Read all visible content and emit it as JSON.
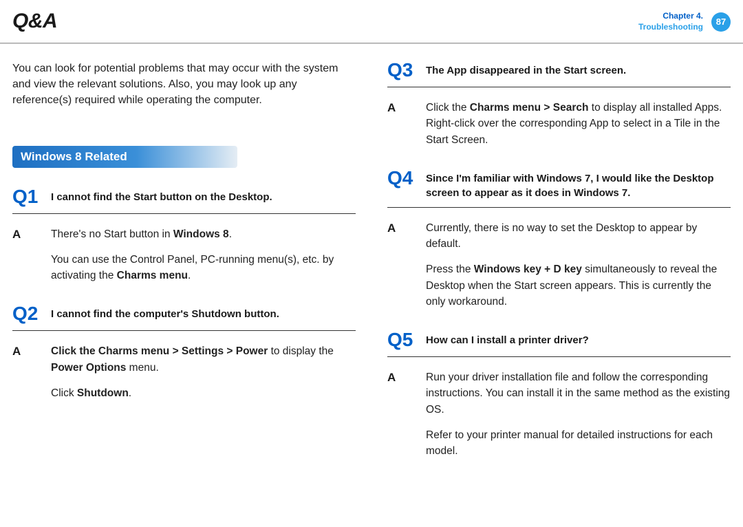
{
  "header": {
    "title": "Q&A",
    "chapter": "Chapter 4.",
    "section": "Troubleshooting",
    "page": "87"
  },
  "intro": "You can look for potential problems that may occur with the system and view the relevant solutions. Also, you may look up any reference(s) required while operating the computer.",
  "section_label": "Windows 8 Related",
  "q1": {
    "num": "Q1",
    "text": "I cannot find the Start button on the Desktop.",
    "a_label": "A",
    "a_p1_pre": "There's no Start button in ",
    "a_p1_b": "Windows 8",
    "a_p1_post": ".",
    "a_p2_pre": "You can use the Control Panel, PC-running menu(s), etc. by activating the ",
    "a_p2_b": "Charms menu",
    "a_p2_post": "."
  },
  "q2": {
    "num": "Q2",
    "text": "I cannot find the computer's Shutdown button.",
    "a_label": "A",
    "a_p1_b1": "Click the Charms menu > Settings > Power",
    "a_p1_mid": " to display the ",
    "a_p1_b2": "Power Options",
    "a_p1_post": " menu.",
    "a_p2_pre": "Click ",
    "a_p2_b": "Shutdown",
    "a_p2_post": "."
  },
  "q3": {
    "num": "Q3",
    "text": "The App disappeared in the Start screen.",
    "a_label": "A",
    "a_p1_pre": "Click the ",
    "a_p1_b": "Charms menu > Search",
    "a_p1_post": " to display all installed Apps. Right-click over the corresponding App to select in a Tile in the Start Screen."
  },
  "q4": {
    "num": "Q4",
    "text": "Since I'm familiar with Windows 7, I would like the Desktop screen to appear as it does in Windows 7.",
    "a_label": "A",
    "a_p1": "Currently, there is no way to set the Desktop to appear by default.",
    "a_p2_pre": "Press the ",
    "a_p2_b": "Windows key + D key",
    "a_p2_post": " simultaneously to reveal the Desktop when the Start screen appears. This is currently the only workaround."
  },
  "q5": {
    "num": "Q5",
    "text": "How can I install a printer driver?",
    "a_label": "A",
    "a_p1": "Run your driver installation file and follow the corresponding instructions. You can install it in the same method as the existing OS.",
    "a_p2": "Refer to your printer manual for detailed instructions for each model."
  }
}
